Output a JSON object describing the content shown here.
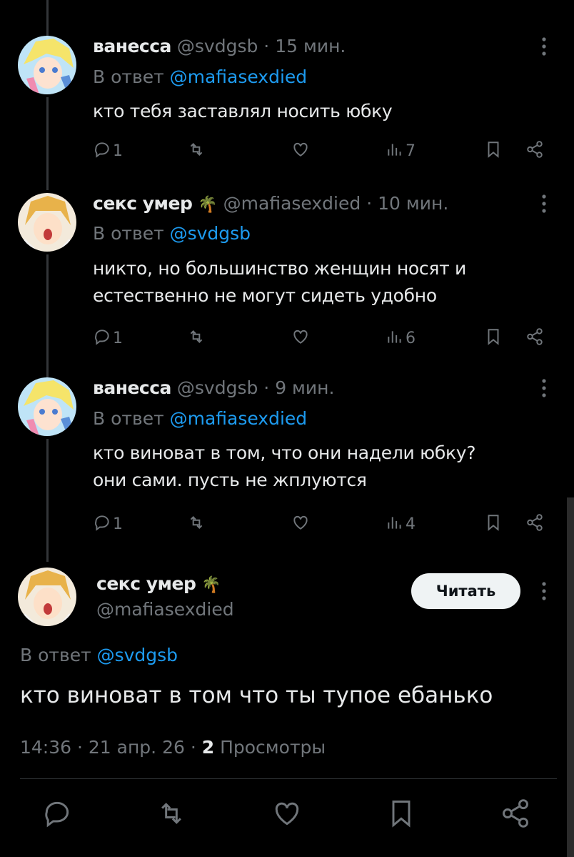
{
  "tweets": [
    {
      "name": "ванесса",
      "handle": "@svdgsb",
      "time": "15 мин.",
      "reply_prefix": "В ответ",
      "reply_to": "@mafiasexdied",
      "text_lines": [
        "кто тебя заставлял носить юбку"
      ],
      "replies": "1",
      "views": "7"
    },
    {
      "name": "секс умер",
      "name_emoji": "🌴",
      "handle": "@mafiasexdied",
      "time": "10 мин.",
      "reply_prefix": "В ответ",
      "reply_to": "@svdgsb",
      "text_lines": [
        "никто, но большинство женщин носят и",
        "естественно не могут сидеть удобно"
      ],
      "replies": "1",
      "views": "6"
    },
    {
      "name": "ванесса",
      "handle": "@svdgsb",
      "time": "9 мин.",
      "reply_prefix": "В ответ",
      "reply_to": "@mafiasexdied",
      "text_lines": [
        "кто виноват в том, что они надели юбку?",
        "они сами. пусть не жплуются"
      ],
      "replies": "1",
      "views": "4"
    }
  ],
  "main_tweet": {
    "name": "секс умер",
    "name_emoji": "🌴",
    "handle": "@mafiasexdied",
    "follow_label": "Читать",
    "reply_prefix": "В ответ",
    "reply_to": "@svdgsb",
    "text": "кто виноват в том что ты тупое ебанько",
    "timestamp": "14:36 · 21 апр. 26 ·",
    "views_count": "2",
    "views_label": "Просмотры"
  },
  "separator": "·",
  "icons": [
    "reply-icon",
    "retweet-icon",
    "like-icon",
    "views-icon",
    "bookmark-icon",
    "share-icon",
    "more-icon"
  ],
  "colors": {
    "background": "#000000",
    "text": "#e7e9ea",
    "muted": "#71767b",
    "link": "#1d9bf0"
  }
}
